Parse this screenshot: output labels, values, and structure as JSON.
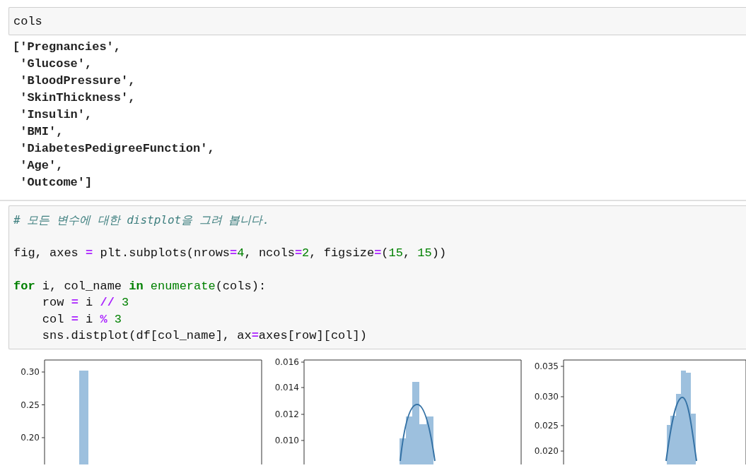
{
  "cells": [
    {
      "input": [
        {
          "kind": "code",
          "tokens": [
            {
              "kind": "plain",
              "text": "cols"
            }
          ]
        }
      ],
      "output": {
        "kind": "text",
        "lines": [
          "['Pregnancies',",
          " 'Glucose',",
          " 'BloodPressure',",
          " 'SkinThickness',",
          " 'Insulin',",
          " 'BMI',",
          " 'DiabetesPedigreeFunction',",
          " 'Age',",
          " 'Outcome']"
        ]
      }
    },
    {
      "input": [
        {
          "kind": "code",
          "tokens": [
            {
              "kind": "comment",
              "text": "# 모든 변수에 대한 distplot을 그려 봅니다."
            }
          ]
        },
        {
          "kind": "blank"
        },
        {
          "kind": "code",
          "tokens": [
            {
              "kind": "plain",
              "text": "fig, axes "
            },
            {
              "kind": "operator",
              "text": "="
            },
            {
              "kind": "plain",
              "text": " plt.subplots(nrows"
            },
            {
              "kind": "operator",
              "text": "="
            },
            {
              "kind": "number",
              "text": "4"
            },
            {
              "kind": "plain",
              "text": ", ncols"
            },
            {
              "kind": "operator",
              "text": "="
            },
            {
              "kind": "number",
              "text": "2"
            },
            {
              "kind": "plain",
              "text": ", figsize"
            },
            {
              "kind": "operator",
              "text": "="
            },
            {
              "kind": "plain",
              "text": "("
            },
            {
              "kind": "number",
              "text": "15"
            },
            {
              "kind": "plain",
              "text": ", "
            },
            {
              "kind": "number",
              "text": "15"
            },
            {
              "kind": "plain",
              "text": "))"
            }
          ]
        },
        {
          "kind": "blank"
        },
        {
          "kind": "code",
          "tokens": [
            {
              "kind": "keyword",
              "text": "for"
            },
            {
              "kind": "plain",
              "text": " i, col_name "
            },
            {
              "kind": "keyword",
              "text": "in"
            },
            {
              "kind": "builtin",
              "text": " enumerate"
            },
            {
              "kind": "plain",
              "text": "(cols):"
            }
          ]
        },
        {
          "kind": "code",
          "tokens": [
            {
              "kind": "plain",
              "text": "    row "
            },
            {
              "kind": "operator",
              "text": "="
            },
            {
              "kind": "plain",
              "text": " i "
            },
            {
              "kind": "operator",
              "text": "//"
            },
            {
              "kind": "number",
              "text": " 3"
            }
          ]
        },
        {
          "kind": "code",
          "tokens": [
            {
              "kind": "plain",
              "text": "    col "
            },
            {
              "kind": "operator",
              "text": "="
            },
            {
              "kind": "plain",
              "text": " i "
            },
            {
              "kind": "operator",
              "text": "%"
            },
            {
              "kind": "number",
              "text": " 3"
            }
          ]
        },
        {
          "kind": "code",
          "tokens": [
            {
              "kind": "plain",
              "text": "    sns.distplot(df[col_name], ax"
            },
            {
              "kind": "operator",
              "text": "="
            },
            {
              "kind": "plain",
              "text": "axes[row][col])"
            }
          ]
        }
      ],
      "output": {
        "kind": "plots",
        "plots": [
          {
            "y_tick_labels": [
              "0.30",
              "0.25",
              "0.20"
            ]
          },
          {
            "y_tick_labels": [
              "0.016",
              "0.014",
              "0.012",
              "0.010"
            ]
          },
          {
            "y_tick_labels": [
              "0.035",
              "0.030",
              "0.025",
              "0.020"
            ]
          }
        ]
      }
    }
  ]
}
